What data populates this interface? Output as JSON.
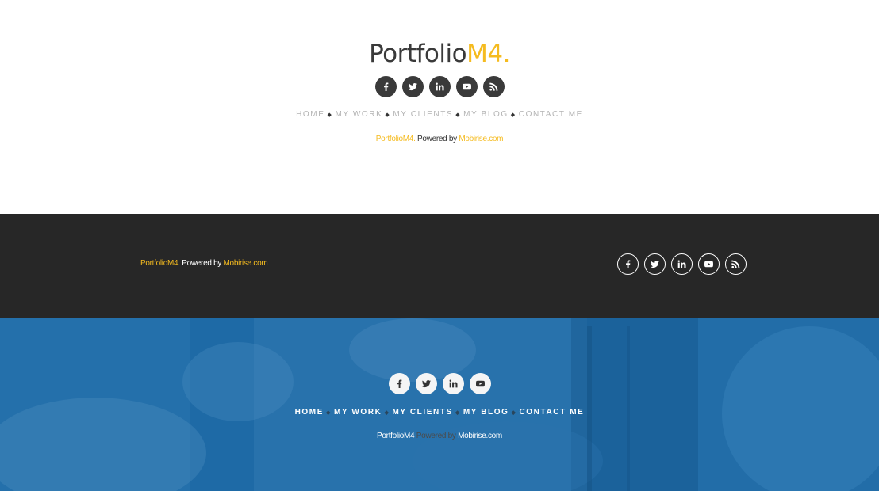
{
  "brand": {
    "main": "Portfolio",
    "accent": "M4."
  },
  "menu": [
    "HOME",
    "MY WORK",
    "MY CLIENTS",
    "MY BLOG",
    "CONTACT ME"
  ],
  "separator": "◆",
  "credits_white": {
    "brand": "PortfolioM4.",
    "text": " Powered by ",
    "link": "Mobirise.com"
  },
  "credits_dark": {
    "brand": "PortfolioM4.",
    "text": " Powered by ",
    "link": "Mobirise.com"
  },
  "credits_blue": {
    "brand": "PortfolioM4",
    "text": " Powered by ",
    "link": "Mobirise.com"
  },
  "social_icons_full": [
    "facebook-icon",
    "twitter-icon",
    "linkedin-icon",
    "youtube-icon",
    "rss-icon"
  ],
  "social_icons_blue": [
    "facebook-icon",
    "twitter-icon",
    "linkedin-icon",
    "youtube-icon"
  ],
  "colors": {
    "accent": "#f5bb1f",
    "dark_section": "#272727",
    "blue_section": "#1e6aa6",
    "text_dark": "#3a3a3a",
    "menu_grey": "#b3b3b3"
  }
}
